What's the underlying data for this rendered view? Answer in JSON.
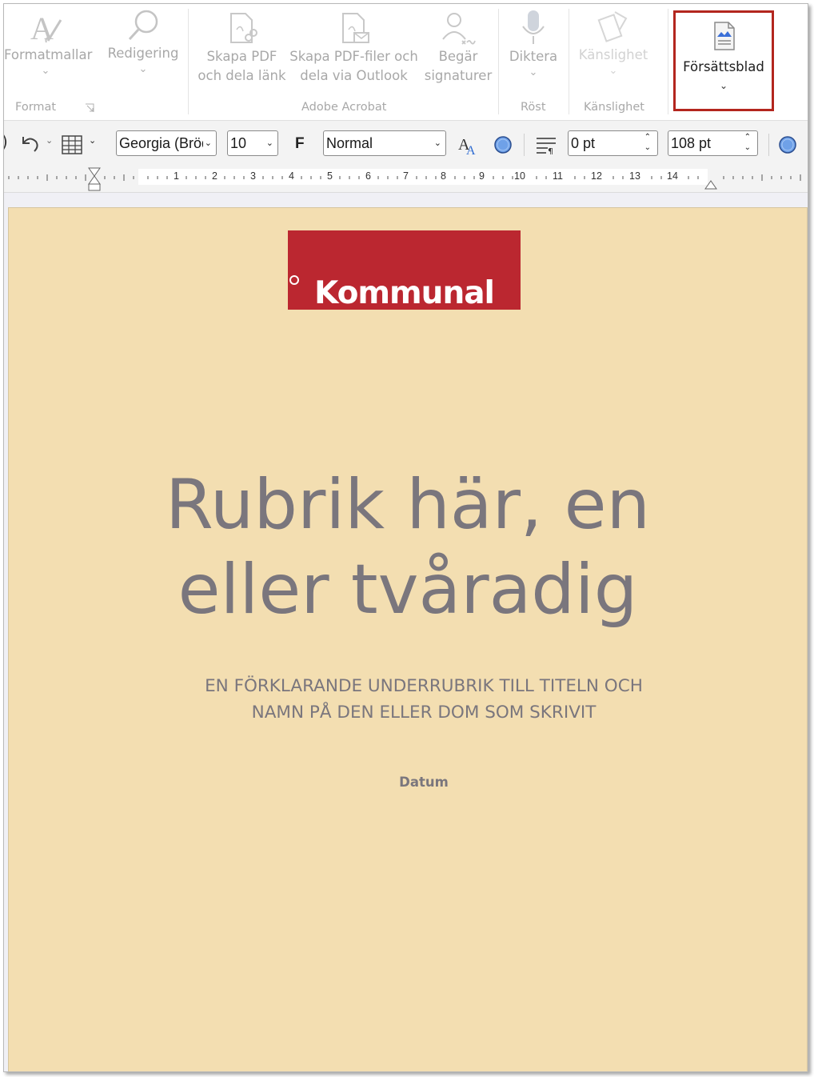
{
  "ribbon": {
    "format_group": {
      "formatmallar_label": "Formatmallar",
      "redigering_label": "Redigering",
      "group_label": "Format"
    },
    "acrobat_group": {
      "skapa_pdf_line1": "Skapa PDF",
      "skapa_pdf_line2": "och dela länk",
      "skapa_outlook_line1": "Skapa PDF-filer och",
      "skapa_outlook_line2": "dela via Outlook",
      "begar_line1": "Begär",
      "begar_line2": "signaturer",
      "group_label": "Adobe Acrobat"
    },
    "rost_group": {
      "diktera_label": "Diktera",
      "group_label": "Röst"
    },
    "kanslighet_group": {
      "kanslighet_label": "Känslighet",
      "group_label": "Känslighet"
    },
    "forsattsblad_label": "Försättsblad",
    "highlight_color": "#b3261e"
  },
  "toolbar": {
    "font_family": "Georgia (Bröd",
    "font_size": "10",
    "bold_label": "F",
    "style": "Normal",
    "spacing_before": "0 pt",
    "spacing_after": "108 pt"
  },
  "ruler": {
    "numbers": [
      "1",
      "2",
      "3",
      "4",
      "5",
      "6",
      "7",
      "8",
      "9",
      "10",
      "11",
      "12",
      "13",
      "14"
    ]
  },
  "document": {
    "background_color": "#f3deb1",
    "logo_text": "Kommunal",
    "logo_color": "#bb2730",
    "title_line1": "Rubrik här, en",
    "title_line2": "eller tvåradig",
    "subtitle_line1": "EN FÖRKLARANDE UNDERRUBRIK TILL TITELN OCH",
    "subtitle_line2": "NAMN PÅ DEN ELLER DOM SOM SKRIVIT",
    "date_label": "Datum"
  }
}
